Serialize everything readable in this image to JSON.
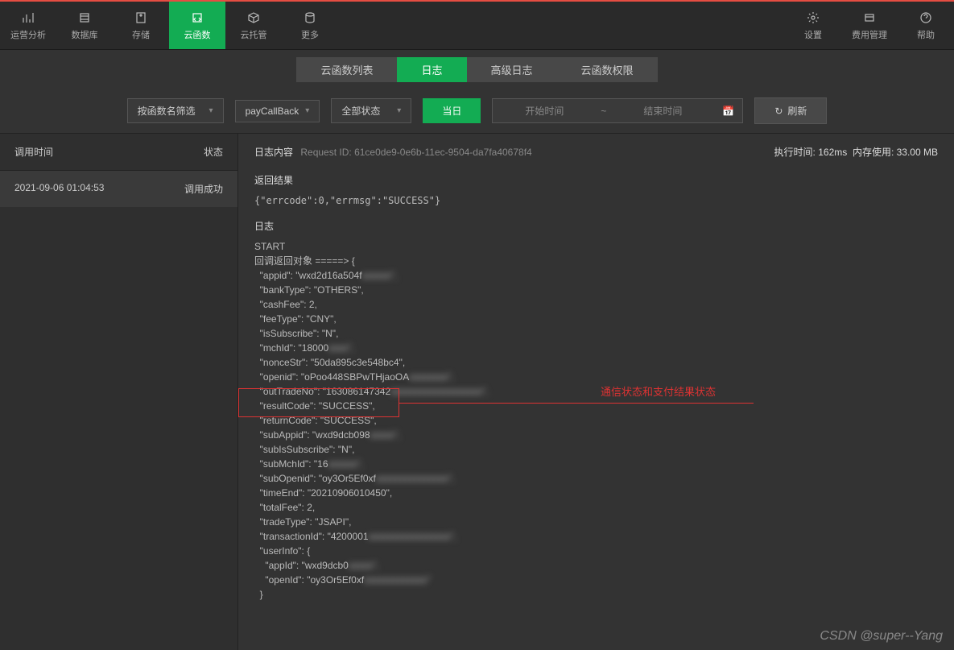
{
  "toolbar": {
    "left": [
      {
        "label": "运营分析",
        "icon": "analytics-icon"
      },
      {
        "label": "数据库",
        "icon": "database-icon"
      },
      {
        "label": "存储",
        "icon": "storage-icon"
      },
      {
        "label": "云函数",
        "icon": "cloudfn-icon",
        "active": true
      },
      {
        "label": "云托管",
        "icon": "cloudrun-icon"
      },
      {
        "label": "更多",
        "icon": "more-icon"
      }
    ],
    "right": [
      {
        "label": "设置",
        "icon": "settings-icon"
      },
      {
        "label": "费用管理",
        "icon": "billing-icon"
      },
      {
        "label": "帮助",
        "icon": "help-icon"
      }
    ]
  },
  "tabs": [
    {
      "label": "云函数列表"
    },
    {
      "label": "日志",
      "active": true
    },
    {
      "label": "高级日志"
    },
    {
      "label": "云函数权限"
    }
  ],
  "filter": {
    "filterByName": "按函数名筛选",
    "fnName": "payCallBack",
    "statusFilter": "全部状态",
    "today": "当日",
    "startTime": "开始时间",
    "endTime": "结束时间",
    "refresh": "刷新"
  },
  "leftPanel": {
    "colTime": "调用时间",
    "colStatus": "状态",
    "rows": [
      {
        "time": "2021-09-06 01:04:53",
        "status": "调用成功"
      }
    ]
  },
  "log": {
    "contentLabel": "日志内容",
    "requestIdLabel": "Request ID:",
    "requestId": "61ce0de9-0e6b-11ec-9504-da7fa40678f4",
    "execTimeLabel": "执行时间:",
    "execTime": "162ms",
    "memLabel": "内存使用:",
    "mem": "33.00 MB",
    "returnResultLabel": "返回结果",
    "returnResult": "{\"errcode\":0,\"errmsg\":\"SUCCESS\"}",
    "logLabel": "日志",
    "lines": {
      "start": "START",
      "cbHeader": "回调返回对象 =====> {",
      "appid": "  \"appid\": \"wxd2d16a504f",
      "appidBlur": "xxxxxx\",",
      "bankType": "  \"bankType\": \"OTHERS\",",
      "cashFee": "  \"cashFee\": 2,",
      "feeType": "  \"feeType\": \"CNY\",",
      "isSubscribe": "  \"isSubscribe\": \"N\",",
      "mchId": "  \"mchId\": \"18000",
      "mchIdBlur": "xxxx\",",
      "nonceStr": "  \"nonceStr\": \"50da895c3e548bc4\",",
      "openid": "  \"openid\": \"oPoo448SBPwTHjaoOA",
      "openidBlur": "xxxxxxxx\",",
      "outTradeNo": "  \"outTradeNo\": \"163086147342",
      "outTradeNoBlur": "xxxxxxxxxxxxxxxxxxx\",",
      "resultCode": "  \"resultCode\": \"SUCCESS\",",
      "returnCode": "  \"returnCode\": \"SUCCESS\",",
      "subAppid": "  \"subAppid\": \"wxd9dcb098",
      "subAppidBlur": "xxxxx\",",
      "subIsSubscribe": "  \"subIsSubscribe\": \"N\",",
      "subMchId": "  \"subMchId\": \"16",
      "subMchIdBlur": "xxxxxx\",",
      "subOpenid": "  \"subOpenid\": \"oy3Or5Ef0xf",
      "subOpenidBlur": "xxxxxxxxxxxxxxx\",",
      "timeEnd": "  \"timeEnd\": \"20210906010450\",",
      "totalFee": "  \"totalFee\": 2,",
      "tradeType": "  \"tradeType\": \"JSAPI\",",
      "transactionId": "  \"transactionId\": \"4200001",
      "transactionIdBlur": "xxxxxxxxxxxxxxxxx\",",
      "userInfo": "  \"userInfo\": {",
      "uiAppId": "    \"appId\": \"wxd9dcb0",
      "uiAppIdBlur": "xxxxx\",",
      "uiOpenId": "    \"openId\": \"oy3Or5Ef0xf",
      "uiOpenIdBlur": "xxxxxxxxxxxxx\"",
      "closeUi": "  }"
    }
  },
  "annotation": "通信状态和支付结果状态",
  "watermark": "CSDN @super--Yang"
}
